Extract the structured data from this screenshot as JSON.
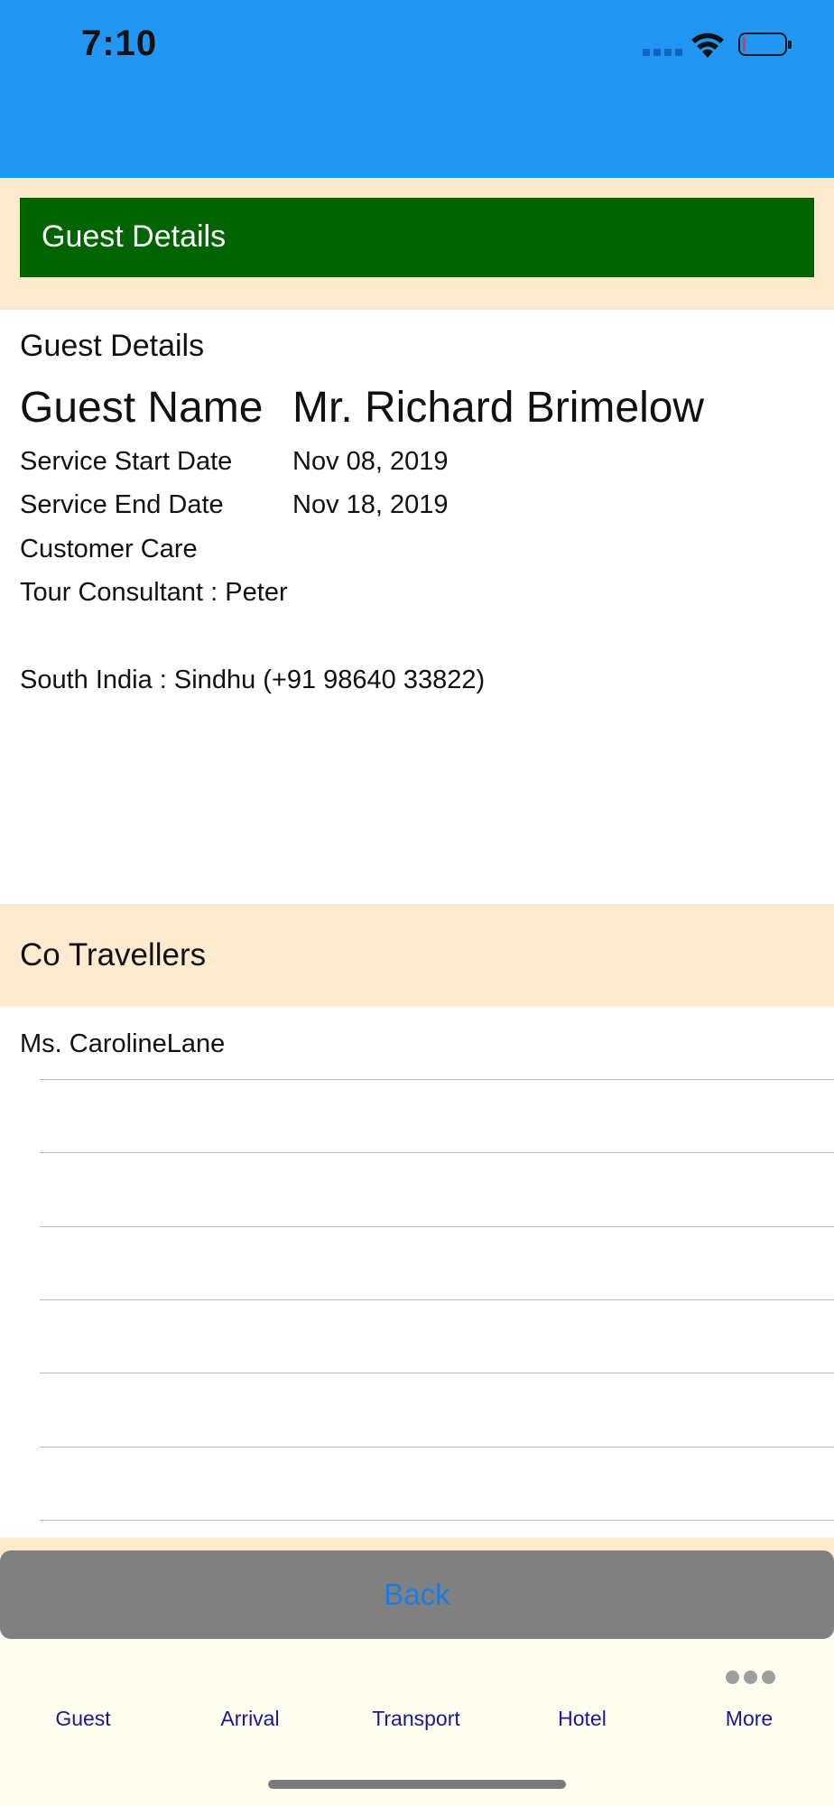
{
  "status_bar": {
    "time": "7:10",
    "battery_color": "#e53935"
  },
  "header": {
    "title": "Guest Details",
    "background": "#2196f3",
    "banner_color": "#006400"
  },
  "guest": {
    "section_title": "Guest Details",
    "name_label": "Guest Name",
    "name_value": "Mr. Richard Brimelow",
    "start_label": "Service Start Date",
    "start_value": "Nov 08, 2019",
    "end_label": "Service End Date",
    "end_value": "Nov 18, 2019",
    "care_label": "Customer Care",
    "consultant": "Tour Consultant : Peter",
    "contact": "South India : Sindhu (+91 98640 33822)"
  },
  "co_travellers": {
    "title": "Co Travellers",
    "rows": [
      "Ms. CarolineLane",
      "",
      "",
      "",
      "",
      "",
      ""
    ]
  },
  "back_button": {
    "label": "Back",
    "color": "#1e7be0"
  },
  "tabs": [
    {
      "label": "Guest"
    },
    {
      "label": "Arrival"
    },
    {
      "label": "Transport"
    },
    {
      "label": "Hotel"
    },
    {
      "label": "More",
      "icon": "more-dots-icon"
    }
  ]
}
